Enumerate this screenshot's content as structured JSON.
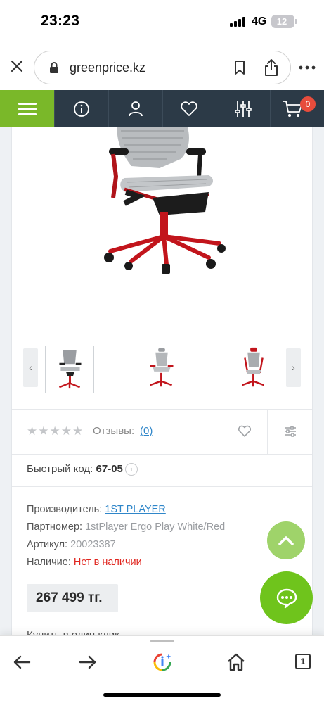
{
  "status_bar": {
    "time": "23:23",
    "network": "4G",
    "battery": "12"
  },
  "browser": {
    "url": "greenprice.kz"
  },
  "site_nav": {
    "cart_count": "0",
    "accent_color": "#7ab829",
    "nav_color": "#2c3a47"
  },
  "product": {
    "stars": "★★★★★",
    "reviews_label": "Отзывы:",
    "reviews_count": "(0)",
    "quick_code_label": "Быстрый код:",
    "quick_code_value": "67-05",
    "manufacturer_label": "Производитель:",
    "manufacturer_value": "1ST PLAYER",
    "part_number_label": "Партномер:",
    "part_number_value": "1stPlayer Ergo Play White/Red",
    "article_label": "Артикул:",
    "article_value": "20023387",
    "availability_label": "Наличие:",
    "availability_value": "Нет в наличии",
    "price": "267 499 тг.",
    "buy_one_click": "Купить в один клик"
  },
  "gallery": {
    "prev_label": "‹",
    "next_label": "›"
  },
  "toolbar": {
    "tabs_count": "1"
  }
}
